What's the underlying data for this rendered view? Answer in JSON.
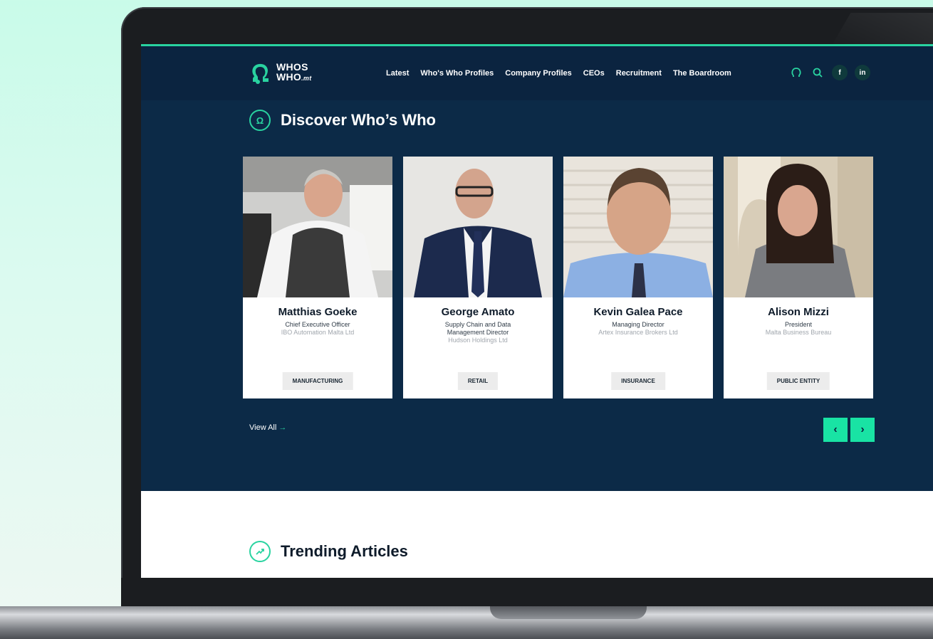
{
  "brand": {
    "logo_line1": "WHOS",
    "logo_line2": "WHO",
    "logo_suffix": ".mt",
    "accent": "#29d3a0",
    "navy": "#0c2a47"
  },
  "nav": {
    "items": [
      "Latest",
      "Who's Who Profiles",
      "Company Profiles",
      "CEOs",
      "Recruitment",
      "The Boardroom"
    ],
    "icons": [
      "omega-icon",
      "search-icon"
    ],
    "social": {
      "facebook": "f",
      "linkedin": "in"
    }
  },
  "discover": {
    "title": "Discover Who’s Who",
    "cards": [
      {
        "name": "Matthias Goeke",
        "role": "Chief Executive Officer",
        "company": "IBO Automation Malta Ltd",
        "tag": "MANUFACTURING"
      },
      {
        "name": "George Amato",
        "role": "Supply Chain and Data Management Director",
        "company": "Hudson Holdings Ltd",
        "tag": "RETAIL"
      },
      {
        "name": "Kevin Galea Pace",
        "role": "Managing Director",
        "company": "Artex Insurance Brokers Ltd",
        "tag": "INSURANCE"
      },
      {
        "name": "Alison Mizzi",
        "role": "President",
        "company": "Malta Business Bureau",
        "tag": "PUBLIC ENTITY"
      }
    ],
    "view_all": "View All",
    "prev": "‹",
    "next": "›"
  },
  "trending": {
    "title": "Trending Articles"
  }
}
